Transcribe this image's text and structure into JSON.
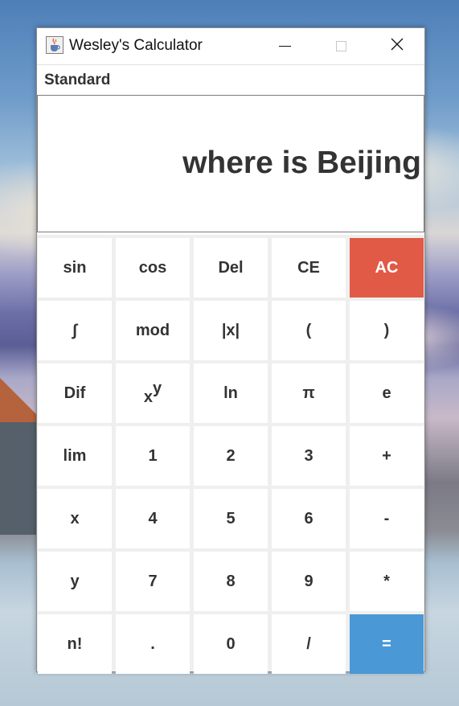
{
  "window": {
    "title": "Wesley's Calculator"
  },
  "menu": {
    "mode": "Standard"
  },
  "display": {
    "text": "where is Beijing"
  },
  "keys": [
    {
      "label": "sin",
      "name": "sin-button"
    },
    {
      "label": "cos",
      "name": "cos-button"
    },
    {
      "label": "Del",
      "name": "delete-button"
    },
    {
      "label": "CE",
      "name": "clear-entry-button"
    },
    {
      "label": "AC",
      "name": "all-clear-button"
    },
    {
      "label": "∫",
      "name": "integral-button"
    },
    {
      "label": "mod",
      "name": "mod-button"
    },
    {
      "label": "|x|",
      "name": "abs-button"
    },
    {
      "label": "(",
      "name": "open-paren-button"
    },
    {
      "label": ")",
      "name": "close-paren-button"
    },
    {
      "label": "Dif",
      "name": "differentiate-button"
    },
    {
      "label": "x",
      "sup": "y",
      "name": "power-button"
    },
    {
      "label": "ln",
      "name": "ln-button"
    },
    {
      "label": "π",
      "name": "pi-button"
    },
    {
      "label": "e",
      "name": "e-button"
    },
    {
      "label": "lim",
      "name": "limit-button"
    },
    {
      "label": "1",
      "name": "digit-1-button"
    },
    {
      "label": "2",
      "name": "digit-2-button"
    },
    {
      "label": "3",
      "name": "digit-3-button"
    },
    {
      "label": "+",
      "name": "plus-button"
    },
    {
      "label": "x",
      "name": "variable-x-button"
    },
    {
      "label": "4",
      "name": "digit-4-button"
    },
    {
      "label": "5",
      "name": "digit-5-button"
    },
    {
      "label": "6",
      "name": "digit-6-button"
    },
    {
      "label": "-",
      "name": "minus-button"
    },
    {
      "label": "y",
      "name": "variable-y-button"
    },
    {
      "label": "7",
      "name": "digit-7-button"
    },
    {
      "label": "8",
      "name": "digit-8-button"
    },
    {
      "label": "9",
      "name": "digit-9-button"
    },
    {
      "label": "*",
      "name": "multiply-button"
    },
    {
      "label": "n!",
      "name": "factorial-button"
    },
    {
      "label": ".",
      "name": "decimal-button"
    },
    {
      "label": "0",
      "name": "digit-0-button"
    },
    {
      "label": "/",
      "name": "divide-button"
    },
    {
      "label": "=",
      "name": "equals-button"
    }
  ],
  "colors": {
    "ac_key": "#e05a46",
    "equals_key": "#4a98d6",
    "key_text": "#333333",
    "key_background": "#ffffff",
    "keypad_gap": "#efefef"
  },
  "icons": {
    "app": "java-cup-icon",
    "minimize": "minimize-icon",
    "maximize": "maximize-icon",
    "close": "close-icon"
  }
}
